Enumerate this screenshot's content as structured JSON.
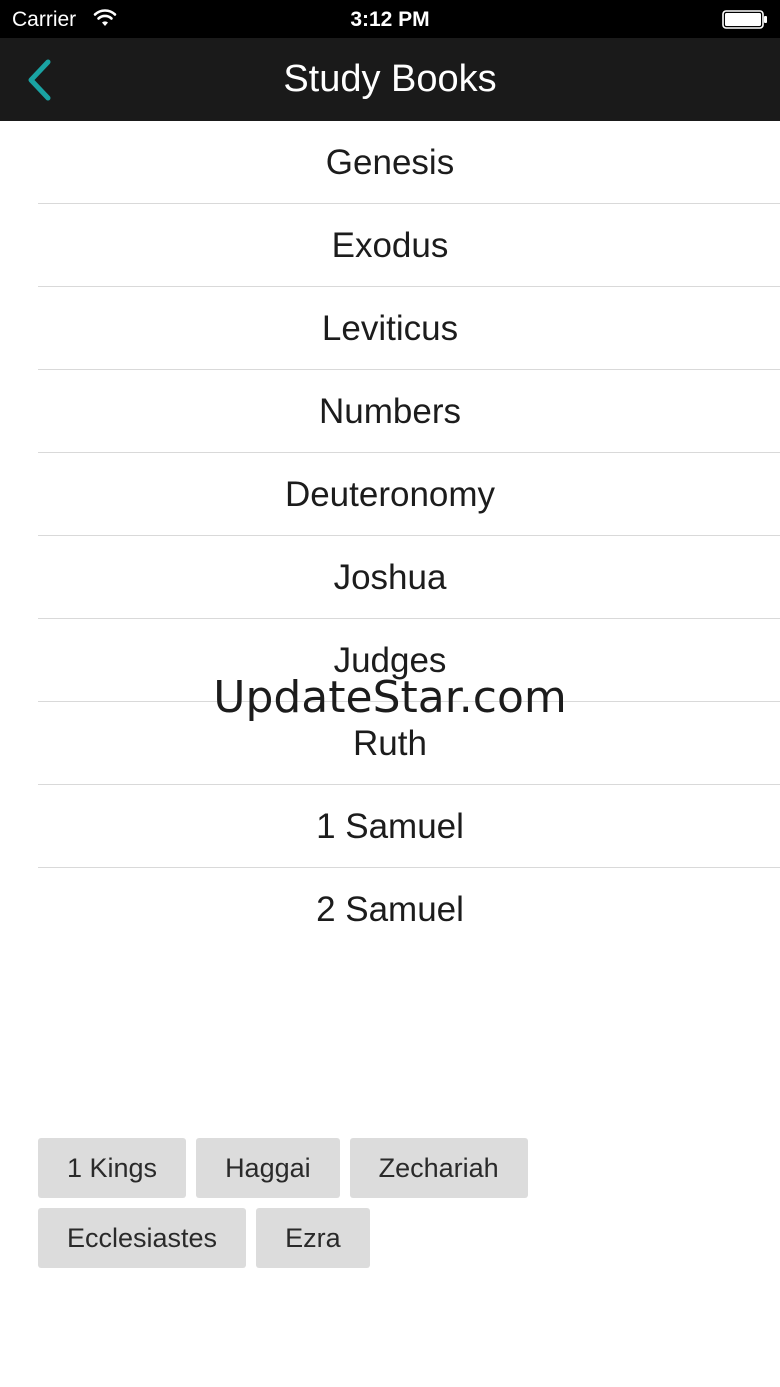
{
  "status_bar": {
    "carrier": "Carrier",
    "time": "3:12 PM",
    "icons": [
      "wifi-icon",
      "battery-icon"
    ]
  },
  "nav": {
    "title": "Study Books",
    "back_icon": "chevron-left-icon",
    "accent_color": "#1aa3a3"
  },
  "books": [
    "Genesis",
    "Exodus",
    "Leviticus",
    "Numbers",
    "Deuteronomy",
    "Joshua",
    "Judges",
    "Ruth",
    "1 Samuel",
    "2 Samuel"
  ],
  "watermark": "UpdateStar.com",
  "tags": {
    "row1": [
      "1 Kings",
      "Haggai",
      "Zechariah"
    ],
    "row2": [
      "Ecclesiastes",
      "Ezra"
    ]
  }
}
